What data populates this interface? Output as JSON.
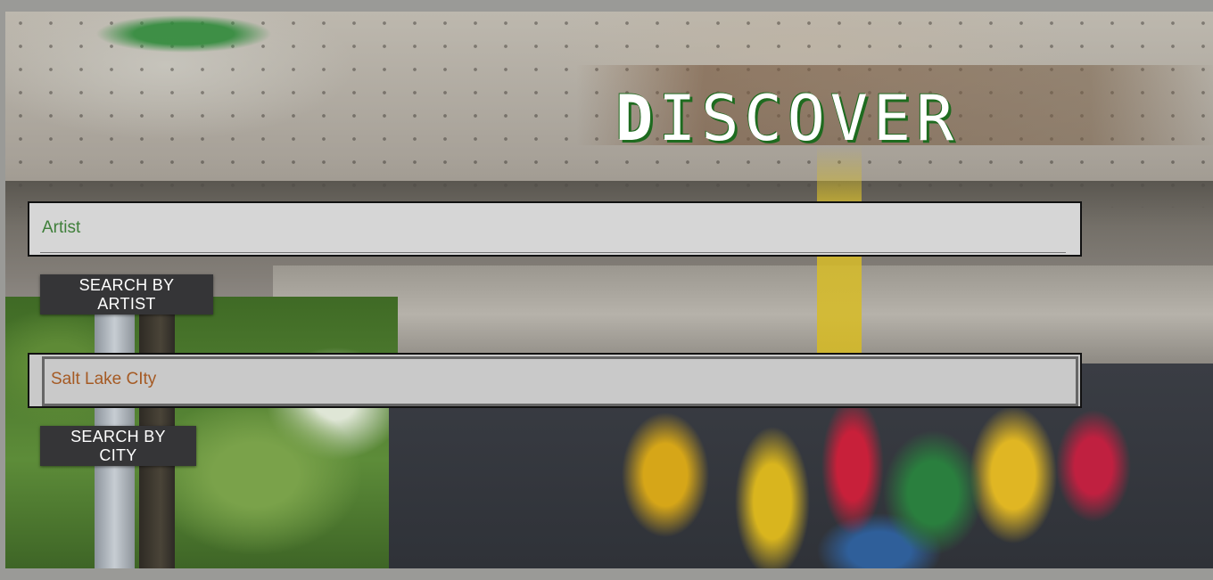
{
  "hero": {
    "title_first": "D",
    "title_rest": "ISCOVER"
  },
  "search": {
    "artist_placeholder": "Artist",
    "artist_value": "",
    "artist_button": "SEARCH BY ARTIST",
    "city_value": "Salt Lake CIty",
    "city_button": "SEARCH BY CITY"
  },
  "colors": {
    "title_shadow": "#1e6b1f",
    "artist_text": "#3f7f3a",
    "city_text": "#a55a24",
    "button_bg": "#353537"
  }
}
